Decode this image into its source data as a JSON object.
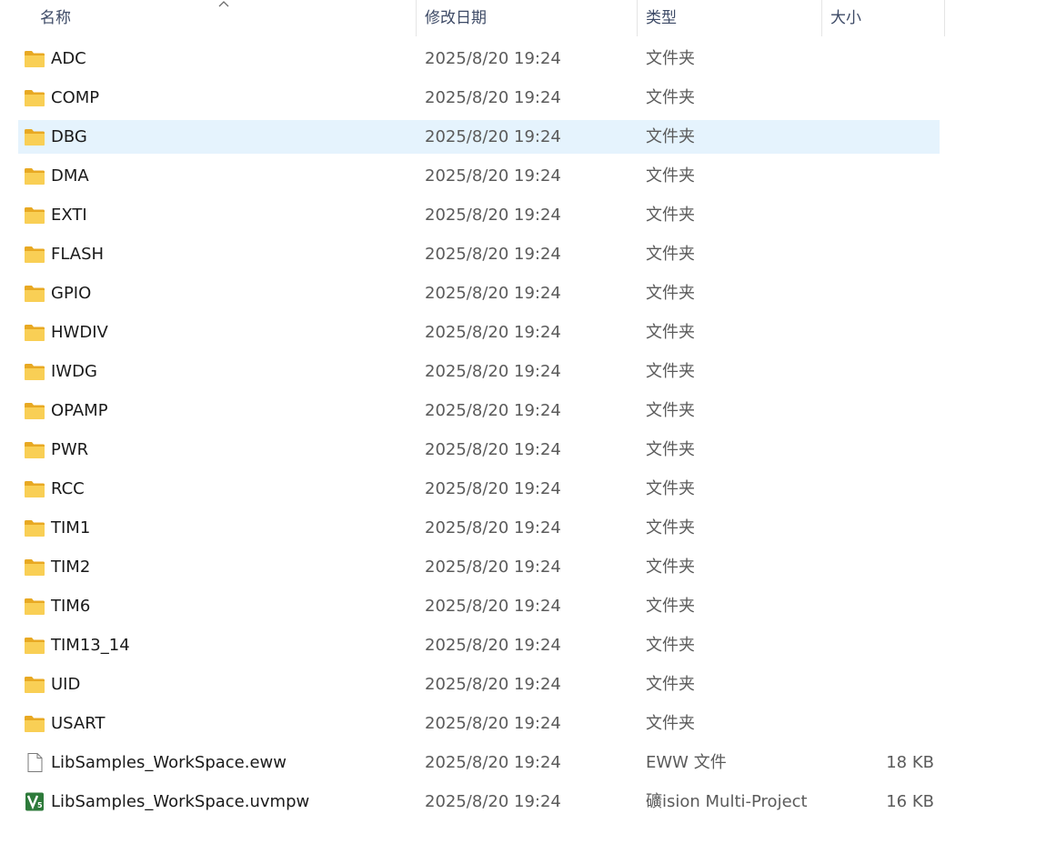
{
  "columns": {
    "name": "名称",
    "date": "修改日期",
    "type": "类型",
    "size": "大小"
  },
  "colors": {
    "folder": "#f6c444",
    "selected_row": "#e5f3fd",
    "uvision_icon": "#2d7a3a"
  },
  "rows": [
    {
      "name": "ADC",
      "date": "2025/8/20 19:24",
      "type": "文件夹",
      "size": "",
      "icon": "folder-icon"
    },
    {
      "name": "COMP",
      "date": "2025/8/20 19:24",
      "type": "文件夹",
      "size": "",
      "icon": "folder-icon"
    },
    {
      "name": "DBG",
      "date": "2025/8/20 19:24",
      "type": "文件夹",
      "size": "",
      "icon": "folder-icon",
      "selected": true
    },
    {
      "name": "DMA",
      "date": "2025/8/20 19:24",
      "type": "文件夹",
      "size": "",
      "icon": "folder-icon"
    },
    {
      "name": "EXTI",
      "date": "2025/8/20 19:24",
      "type": "文件夹",
      "size": "",
      "icon": "folder-icon"
    },
    {
      "name": "FLASH",
      "date": "2025/8/20 19:24",
      "type": "文件夹",
      "size": "",
      "icon": "folder-icon"
    },
    {
      "name": "GPIO",
      "date": "2025/8/20 19:24",
      "type": "文件夹",
      "size": "",
      "icon": "folder-icon"
    },
    {
      "name": "HWDIV",
      "date": "2025/8/20 19:24",
      "type": "文件夹",
      "size": "",
      "icon": "folder-icon"
    },
    {
      "name": "IWDG",
      "date": "2025/8/20 19:24",
      "type": "文件夹",
      "size": "",
      "icon": "folder-icon"
    },
    {
      "name": "OPAMP",
      "date": "2025/8/20 19:24",
      "type": "文件夹",
      "size": "",
      "icon": "folder-icon"
    },
    {
      "name": "PWR",
      "date": "2025/8/20 19:24",
      "type": "文件夹",
      "size": "",
      "icon": "folder-icon"
    },
    {
      "name": "RCC",
      "date": "2025/8/20 19:24",
      "type": "文件夹",
      "size": "",
      "icon": "folder-icon"
    },
    {
      "name": "TIM1",
      "date": "2025/8/20 19:24",
      "type": "文件夹",
      "size": "",
      "icon": "folder-icon"
    },
    {
      "name": "TIM2",
      "date": "2025/8/20 19:24",
      "type": "文件夹",
      "size": "",
      "icon": "folder-icon"
    },
    {
      "name": "TIM6",
      "date": "2025/8/20 19:24",
      "type": "文件夹",
      "size": "",
      "icon": "folder-icon"
    },
    {
      "name": "TIM13_14",
      "date": "2025/8/20 19:24",
      "type": "文件夹",
      "size": "",
      "icon": "folder-icon"
    },
    {
      "name": "UID",
      "date": "2025/8/20 19:24",
      "type": "文件夹",
      "size": "",
      "icon": "folder-icon"
    },
    {
      "name": "USART",
      "date": "2025/8/20 19:24",
      "type": "文件夹",
      "size": "",
      "icon": "folder-icon"
    },
    {
      "name": "LibSamples_WorkSpace.eww",
      "date": "2025/8/20 19:24",
      "type": "EWW 文件",
      "size": "18 KB",
      "icon": "file-icon"
    },
    {
      "name": "LibSamples_WorkSpace.uvmpw",
      "date": "2025/8/20 19:24",
      "type": "礦ision Multi-Project",
      "size": "16 KB",
      "icon": "uvision-icon"
    }
  ]
}
